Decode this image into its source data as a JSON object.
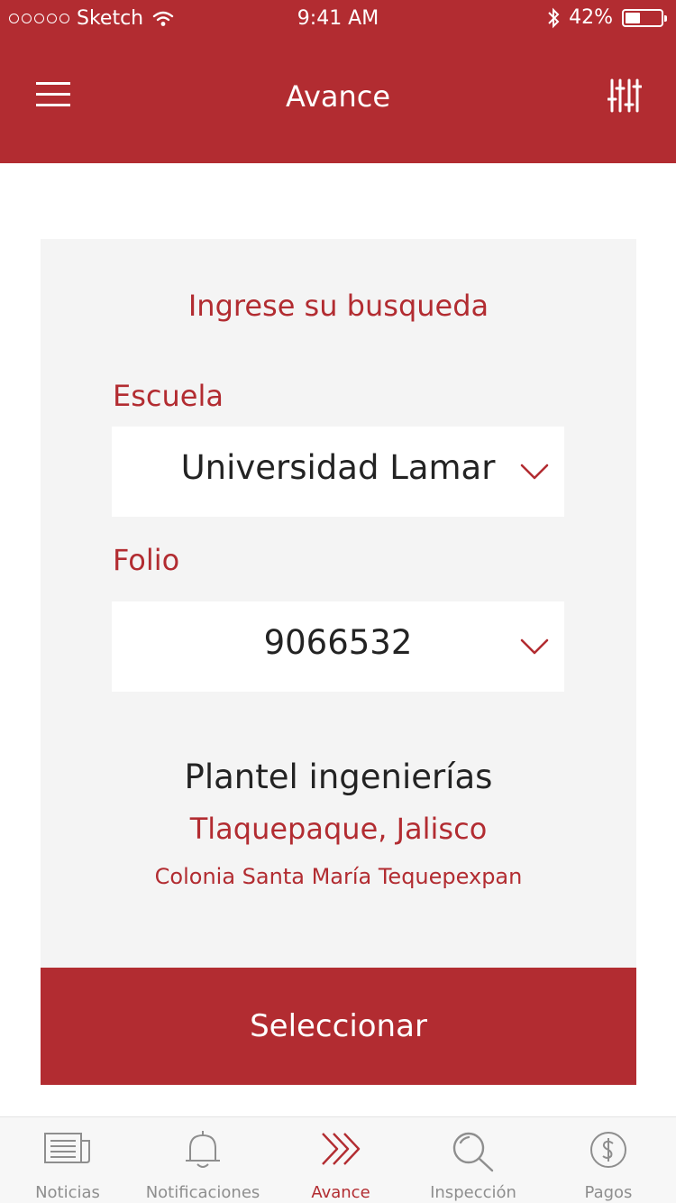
{
  "status_bar": {
    "carrier": "Sketch",
    "time": "9:41 AM",
    "battery_percent": "42%",
    "battery_level": 0.42,
    "icons": [
      "signal-dots-icon",
      "wifi-icon",
      "bluetooth-icon",
      "battery-icon"
    ]
  },
  "navbar": {
    "title": "Avance",
    "left_icon": "hamburger-menu-icon",
    "right_icon": "filter-sliders-icon"
  },
  "search": {
    "prompt": "Ingrese su busqueda",
    "escuela_label": "Escuela",
    "escuela_value": "Universidad Lamar",
    "folio_label": "Folio",
    "folio_value": "9066532"
  },
  "result": {
    "name": "Plantel ingenierías",
    "city": "Tlaquepaque, Jalisco",
    "colony": "Colonia Santa María Tequepexpan"
  },
  "actions": {
    "select_label": "Seleccionar"
  },
  "tabs": [
    {
      "label": "Noticias",
      "icon": "newspaper-icon",
      "active": false
    },
    {
      "label": "Notificaciones",
      "icon": "bell-icon",
      "active": false
    },
    {
      "label": "Avance",
      "icon": "double-chevron-right-icon",
      "active": true
    },
    {
      "label": "Inspección",
      "icon": "magnifier-icon",
      "active": false
    },
    {
      "label": "Pagos",
      "icon": "dollar-coin-icon",
      "active": false
    }
  ],
  "colors": {
    "brand": "#b22c31",
    "card_bg": "#f4f4f4",
    "text_dark": "#232323",
    "tab_inactive": "#8e8e8e"
  }
}
